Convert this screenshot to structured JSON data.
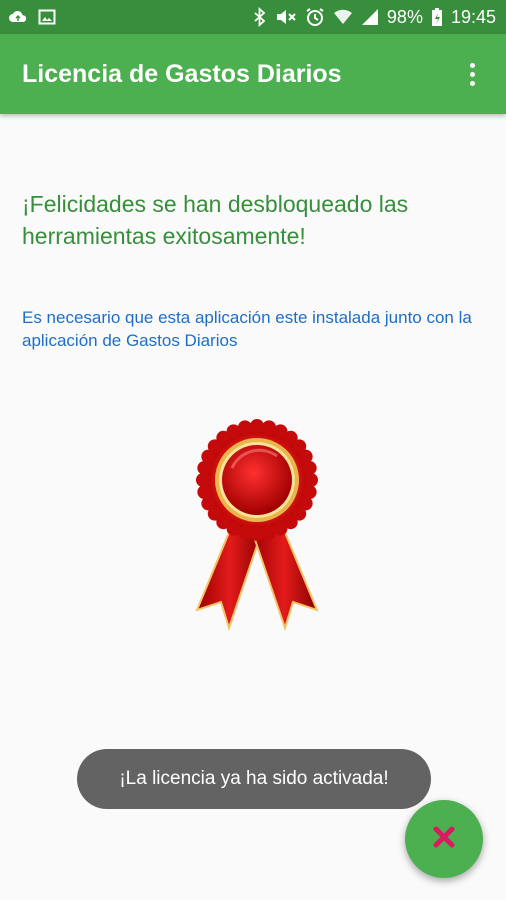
{
  "status_bar": {
    "battery": "98%",
    "time": "19:45",
    "icons": [
      "cloud-sync-icon",
      "image-icon",
      "bluetooth-icon",
      "mute-icon",
      "alarm-icon",
      "wifi-icon",
      "signal-icon",
      "battery-charging-icon"
    ]
  },
  "app_bar": {
    "title": "Licencia de Gastos Diarios",
    "menu_icon": "overflow-menu-icon"
  },
  "content": {
    "headline": "¡Felicidades se han desbloqueado las herramientas exitosamente!",
    "info": "Es necesario que esta aplicación este instalada junto con la aplicación de Gastos Diarios",
    "image_icon": "award-ribbon-icon"
  },
  "toast": {
    "message": "¡La licencia ya ha sido activada!"
  },
  "fab": {
    "icon": "close-icon"
  },
  "colors": {
    "status_bar": "#388e3c",
    "app_bar": "#4caf50",
    "headline": "#388e3c",
    "info": "#1e6ec8",
    "toast": "#636363",
    "fab": "#4caf50",
    "fab_icon": "#d81b60"
  }
}
